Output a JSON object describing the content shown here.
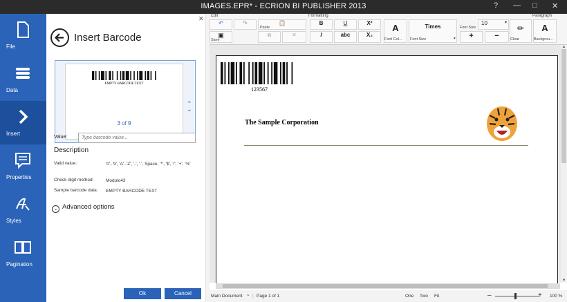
{
  "app": {
    "title": "IMAGES.EPR* - ECRION BI PUBLISHER 2013",
    "help": "?"
  },
  "sidebar": {
    "items": [
      {
        "label": "File",
        "icon": "file-icon"
      },
      {
        "label": "Data",
        "icon": "data-icon"
      },
      {
        "label": "Insert",
        "icon": "chevron-right-icon"
      },
      {
        "label": "Properties",
        "icon": "properties-icon"
      },
      {
        "label": "Styles",
        "icon": "styles-icon"
      },
      {
        "label": "Pagination",
        "icon": "pagination-icon"
      }
    ]
  },
  "panel": {
    "title": "Insert Barcode",
    "thumb_text": "EMPTY BARCODE TEXT",
    "thumb_page": "3 of 9",
    "value_label": "Value:",
    "value_placeholder": "Type barcode value...",
    "description_heading": "Description",
    "valid_label": "Valid value:",
    "valid_value": "'0'..'9', 'A'..'Z', '-', '.', Space, '*', '$', '/', '+', '%'",
    "check_label": "Check digit method:",
    "check_value": "Modulo43",
    "sample_label": "Sample barcode data:",
    "sample_value": "EMPTY BARCODE TEXT",
    "advanced_label": "Advanced options",
    "ok_label": "Ok",
    "cancel_label": "Cancel"
  },
  "ribbon": {
    "edit_group": "Edit",
    "formatting_group": "Formatting",
    "paragraph_group": "Paragraph",
    "save_label": "Save",
    "paste_label": "Paste",
    "bold": "B",
    "italic": "I",
    "underline": "U",
    "strike": "abc",
    "superscript": "X²",
    "subscript": "X₂",
    "font_color_label": "Font Col...",
    "font_name": "Times",
    "font_size_caption": "Font Size",
    "font_size_value": "10",
    "font_size_label": "Font Size",
    "clear_label": "Clear",
    "background_label": "Backgrou...",
    "grow": "+",
    "shrink": "−"
  },
  "document": {
    "barcode_number": "123567",
    "company": "The Sample Corporation"
  },
  "status": {
    "main_document": "Main Document",
    "page": "Page 1 of 1",
    "one": "One",
    "two": "Two",
    "fit": "Fit",
    "zoom": "100 %"
  },
  "colors": {
    "accent": "#2a63b8",
    "titlebar": "#2b2b2b"
  }
}
